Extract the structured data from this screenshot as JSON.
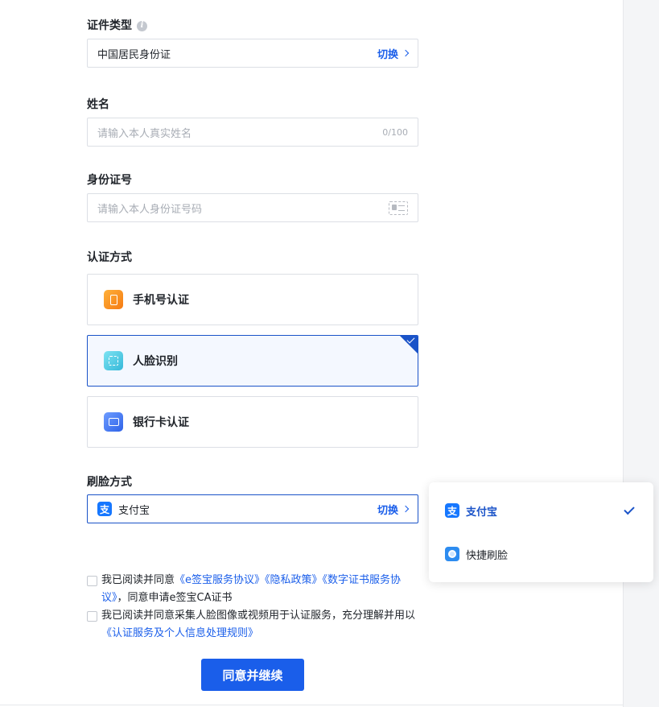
{
  "id_type": {
    "label": "证件类型",
    "info_icon": "info-icon",
    "value": "中国居民身份证",
    "switch_label": "切换"
  },
  "name": {
    "label": "姓名",
    "placeholder": "请输入本人真实姓名",
    "counter": "0/100"
  },
  "id_number": {
    "label": "身份证号",
    "placeholder": "请输入本人身份证号码",
    "icon": "id-card-scan-icon"
  },
  "auth_method": {
    "label": "认证方式",
    "options": [
      {
        "label": "手机号认证",
        "icon": "phone-icon",
        "selected": false
      },
      {
        "label": "人脸识别",
        "icon": "face-scan-icon",
        "selected": true
      },
      {
        "label": "银行卡认证",
        "icon": "bank-card-icon",
        "selected": false
      }
    ]
  },
  "face_method": {
    "label": "刷脸方式",
    "value": "支付宝",
    "logo_char": "支",
    "switch_label": "切换"
  },
  "dropdown": {
    "items": [
      {
        "label": "支付宝",
        "icon": "alipay-icon",
        "selected": true
      },
      {
        "label": "快捷刷脸",
        "icon": "quick-face-icon",
        "selected": false
      }
    ]
  },
  "agreements": {
    "first": {
      "prefix": "我已阅读并同意",
      "link1": "《e签宝服务协议》",
      "link2": "《隐私政策》",
      "link3": "《数字证书服务协议》",
      "suffix": "，同意申请e签宝CA证书"
    },
    "second": {
      "prefix": "我已阅读并同意采集人脸图像或视频用于认证服务，充分理解并用以",
      "link": "《认证服务及个人信息处理规则》"
    }
  },
  "submit_label": "同意并继续",
  "colors": {
    "primary": "#1a5eea",
    "selected_border": "#1a53c8",
    "border": "#dcdfe5"
  }
}
